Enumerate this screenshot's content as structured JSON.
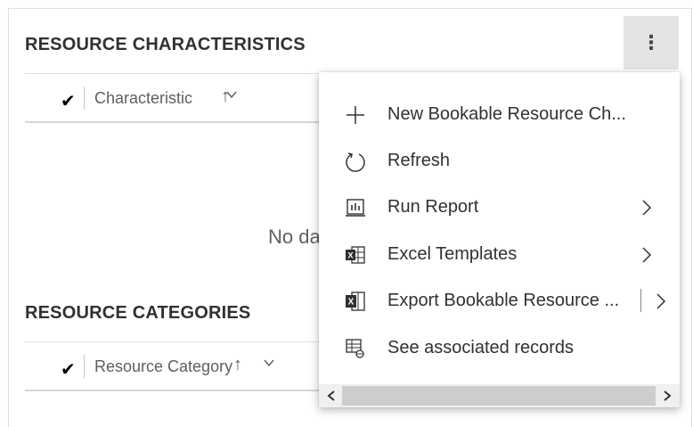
{
  "characteristics": {
    "title": "RESOURCE CHARACTERISTICS",
    "column_label": "Characteristic",
    "sort_arrow": "↑",
    "empty_message": "No da"
  },
  "categories": {
    "title": "RESOURCE CATEGORIES",
    "column_label": "Resource Category",
    "sort_arrow": "↑"
  },
  "more_button": {
    "icon": "more-vertical-icon",
    "glyph": "⋮"
  },
  "menu": {
    "items": [
      {
        "label": "New Bookable Resource Ch...",
        "icon": "plus-icon"
      },
      {
        "label": "Refresh",
        "icon": "refresh-icon"
      },
      {
        "label": "Run Report",
        "icon": "report-icon",
        "submenu": true
      },
      {
        "label": "Excel Templates",
        "icon": "excel-templates-icon",
        "submenu": true
      },
      {
        "label": "Export Bookable Resource ...",
        "icon": "excel-export-icon",
        "submenu": true,
        "split": true
      },
      {
        "label": "See associated records",
        "icon": "associated-records-icon"
      }
    ]
  },
  "checkmark": "✔",
  "colors": {
    "more_button_bg": "#e4e4e4",
    "menu_bg": "#ffffff",
    "text": "#323130",
    "scrollbar_thumb": "#cdcdcd"
  }
}
